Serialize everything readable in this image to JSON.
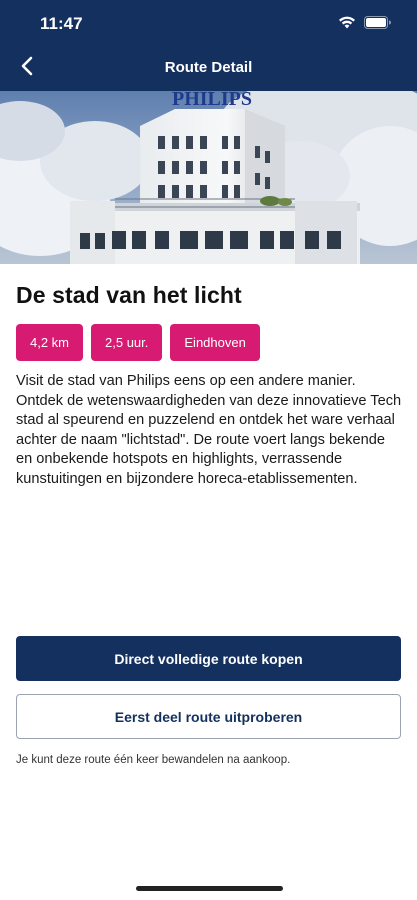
{
  "status_bar": {
    "time": "11:47"
  },
  "nav": {
    "title": "Route Detail"
  },
  "hero": {
    "sign_text": "PHILIPS"
  },
  "route": {
    "title": "De stad van het licht",
    "badges": [
      "4,2 km",
      "2,5 uur.",
      "Eindhoven"
    ],
    "description": "Visit de stad van Philips eens op een andere manier. Ontdek de wetenswaardigheden van deze innovatieve Tech stad al speurend en puzzelend en ontdek het ware verhaal achter de naam \"lichtstad\". De route voert langs bekende en onbekende hotspots en highlights, verrassende kunstuitingen en bijzondere horeca-etablissementen."
  },
  "actions": {
    "buy_label": "Direct volledige route kopen",
    "try_label": "Eerst deel route uitproberen"
  },
  "note": "Je kunt deze route één keer bewandelen na aankoop.",
  "colors": {
    "navy": "#14305e",
    "pink": "#d81b72"
  }
}
